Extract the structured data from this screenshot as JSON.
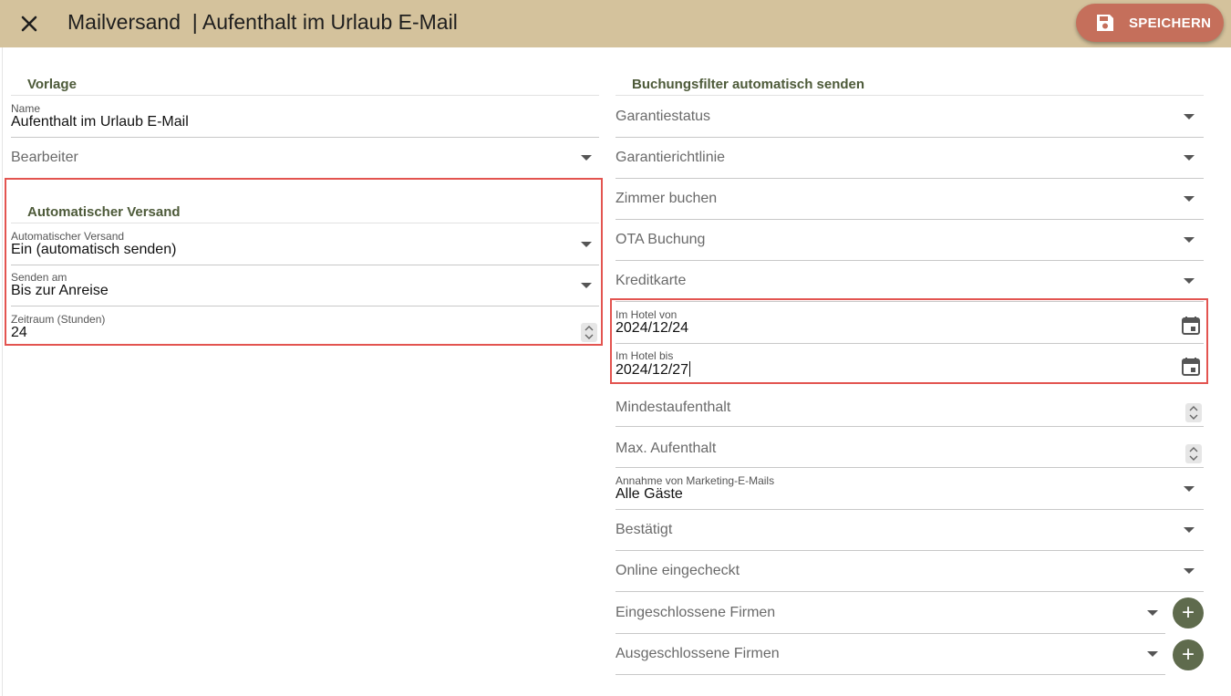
{
  "header": {
    "title": "Mailversand  | Aufenthalt im Urlaub E-Mail",
    "save_label": "SPEICHERN",
    "colors": {
      "bar": "#d4c29c",
      "save": "#c56f5b",
      "accent_green": "#4d5a39",
      "highlight": "#e35450"
    }
  },
  "left": {
    "vorlage": {
      "heading": "Vorlage",
      "name_label": "Name",
      "name_value": "Aufenthalt im Urlaub E-Mail",
      "bearbeiter_placeholder": "Bearbeiter"
    },
    "auto": {
      "heading": "Automatischer Versand",
      "versand_label": "Automatischer Versand",
      "versand_value": "Ein (automatisch senden)",
      "senden_label": "Senden am",
      "senden_value": "Bis zur Anreise",
      "zeitraum_label": "Zeitraum (Stunden)",
      "zeitraum_value": "24"
    }
  },
  "right": {
    "heading": "Buchungsfilter automatisch senden",
    "garantiestatus": "Garantiestatus",
    "garantierichtlinie": "Garantierichtlinie",
    "zimmer_buchen": "Zimmer buchen",
    "ota_buchung": "OTA Buchung",
    "kreditkarte": "Kreditkarte",
    "hotel_von_label": "Im Hotel von",
    "hotel_von_value": "2024/12/24",
    "hotel_bis_label": "Im Hotel bis",
    "hotel_bis_value": "2024/12/27",
    "mindestaufenthalt": "Mindestaufenthalt",
    "max_aufenthalt": "Max. Aufenthalt",
    "marketing_label": "Annahme von Marketing-E-Mails",
    "marketing_value": "Alle Gäste",
    "bestaetigt": "Bestätigt",
    "online_eingecheckt": "Online eingecheckt",
    "eingeschlossene_firmen": "Eingeschlossene Firmen",
    "ausgeschlossene_firmen": "Ausgeschlossene Firmen",
    "add_symbol": "+"
  }
}
